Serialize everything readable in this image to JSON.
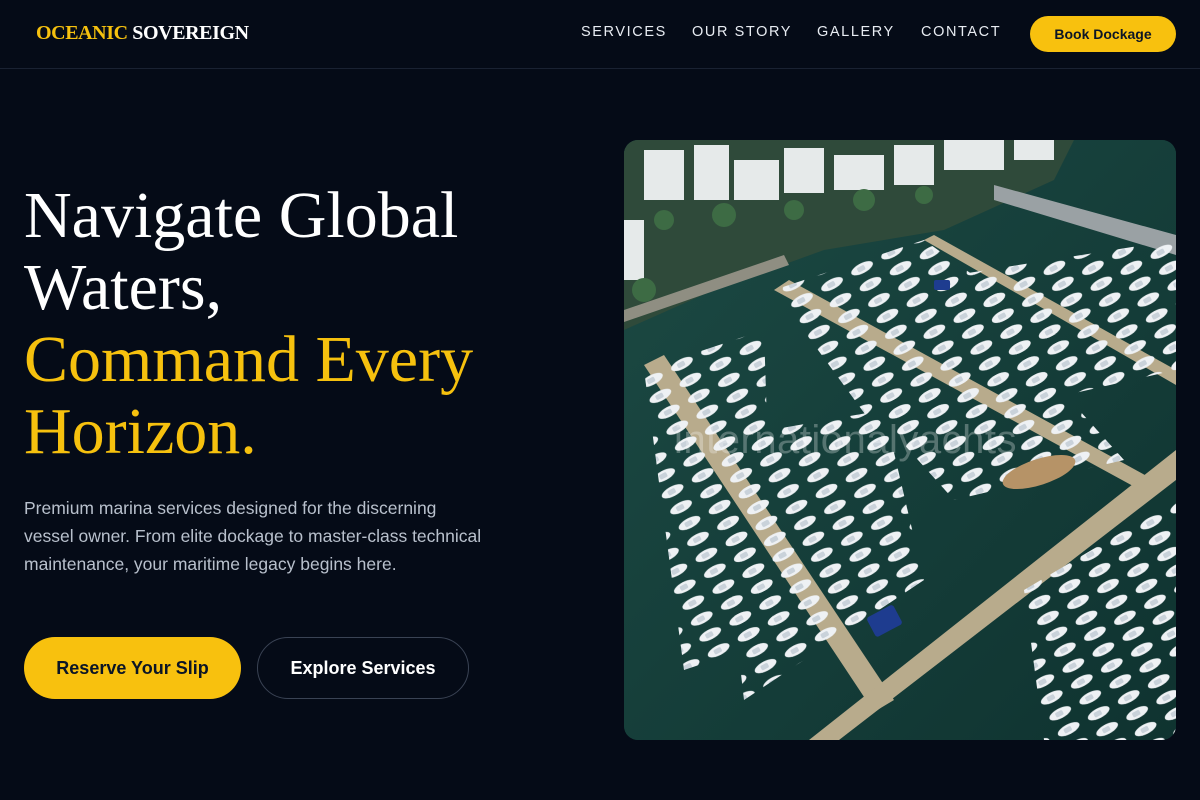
{
  "brand": {
    "accent_word": "OCEANIC",
    "plain_word": "SOVEREIGN",
    "accent_color": "#f6c10e"
  },
  "nav": {
    "items": [
      "SERVICES",
      "OUR STORY",
      "GALLERY",
      "CONTACT"
    ],
    "cta_label": "Book Dockage"
  },
  "hero": {
    "headline_line1": "Navigate Global",
    "headline_line2": "Waters,",
    "headline_line3": "Command Every",
    "headline_line4": "Horizon.",
    "subtitle": "Premium marina services designed for the discerning vessel owner. From elite dockage to master-class technical maintenance, your maritime legacy begins here.",
    "primary_button": "Reserve Your Slip",
    "secondary_button": "Explore Services",
    "image_alt": "Aerial view of a marina with docked yachts",
    "watermark_text": "internationalyachts"
  },
  "colors": {
    "background": "#050b17",
    "gold": "#f8c10e",
    "water": "#123a36"
  }
}
